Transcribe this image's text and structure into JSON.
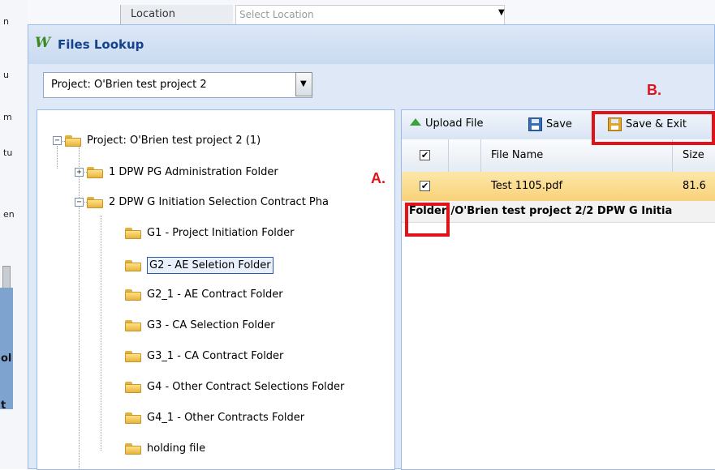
{
  "background": {
    "location_label": "Location",
    "location_placeholder": "Select Location",
    "left_fragments": [
      "n",
      "u",
      "m",
      "tu",
      "en"
    ],
    "left_bold_fragments": [
      "ol",
      "t"
    ]
  },
  "window": {
    "title": "Files Lookup",
    "app_icon_glyph": "W",
    "project_select": {
      "value": "Project: O'Brien test project 2"
    }
  },
  "tree": {
    "root": {
      "label": "Project: O'Brien test project 2 (1)",
      "expander": "−"
    },
    "children": [
      {
        "label": "1 DPW PG Administration Folder",
        "expander": "+"
      },
      {
        "label": "2 DPW G Initiation Selection Contract Pha",
        "expander": "−"
      }
    ],
    "subfolders": [
      {
        "label": "G1 - Project Initiation Folder"
      },
      {
        "label": "G2 - AE Seletion Folder",
        "selected": true
      },
      {
        "label": "G2_1 - AE Contract Folder"
      },
      {
        "label": "G3 - CA Selection Folder"
      },
      {
        "label": "G3_1 - CA Contract Folder"
      },
      {
        "label": "G4 - Other Contract Selections Folder"
      },
      {
        "label": "G4_1 - Other Contracts Folder"
      },
      {
        "label": "holding file"
      }
    ]
  },
  "toolbar": {
    "upload_label": "Upload File",
    "save_label": "Save",
    "save_exit_label": "Save & Exit"
  },
  "grid": {
    "columns": [
      "File Name",
      "Size"
    ],
    "header_checked": true,
    "rows": [
      {
        "checked": true,
        "file_name": "Test 1105.pdf",
        "size": "81.6"
      }
    ],
    "folder_path": "Folder:/O'Brien test project 2/2 DPW G Initia"
  },
  "callouts": {
    "a": "A.",
    "b": "B."
  },
  "colors": {
    "callout_red": "#e0131b",
    "selected_row": "#f9d27a",
    "title_blue": "#15428b"
  }
}
